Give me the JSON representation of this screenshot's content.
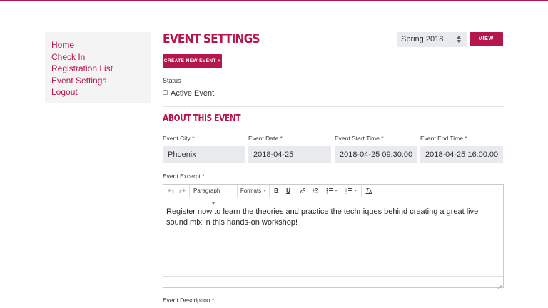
{
  "colors": {
    "accent": "#b5164b",
    "field_bg": "#e8eaed",
    "sidebar_bg": "#f4f4f4"
  },
  "sidebar": {
    "items": [
      {
        "label": "Home"
      },
      {
        "label": "Check In"
      },
      {
        "label": "Registration List"
      },
      {
        "label": "Event Settings"
      },
      {
        "label": "Logout"
      }
    ]
  },
  "header": {
    "title": "EVENT SETTINGS",
    "season_select": {
      "value": "Spring 2018"
    },
    "view_label": "VIEW",
    "create_label": "CREATE NEW EVENT +"
  },
  "status": {
    "label": "Status",
    "active_label": "Active Event",
    "active_checked": false
  },
  "about": {
    "title": "ABOUT THIS EVENT",
    "required_mark": "*",
    "fields": [
      {
        "label": "Event City",
        "value": "Phoenix"
      },
      {
        "label": "Event Date",
        "value": "2018-04-25"
      },
      {
        "label": "Event Start Time",
        "value": "2018-04-25 09:30:00"
      },
      {
        "label": "Event End Time",
        "value": "2018-04-25 16:00:00"
      }
    ]
  },
  "excerpt": {
    "label": "Event Excerpt",
    "toolbar": {
      "undo_icon": "undo-icon",
      "redo_icon": "redo-icon",
      "block_format": "Paragraph",
      "formats": "Formats",
      "bold": "B",
      "underline": "U",
      "link_icon": "link-icon",
      "unlink_icon": "unlink-icon",
      "bullet_list_icon": "bullet-list-icon",
      "numbered_list_icon": "numbered-list-icon",
      "clear_format": "Tx"
    },
    "content": "Register now to learn the theories and practice the techniques behind creating a great live sound mix in this hands-on workshop!"
  },
  "description": {
    "label": "Event Description"
  }
}
